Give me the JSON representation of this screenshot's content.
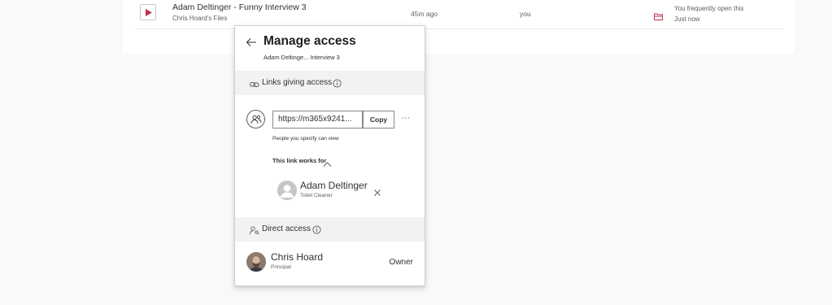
{
  "file_row": {
    "name": "Adam Deltinger - Funny Interview 3",
    "location": "Chris Hoard's Files",
    "modified": "45m ago",
    "modified_by": "you",
    "activity_line1": "You frequently open this",
    "activity_line2": "Just now",
    "video_icon": "play-icon",
    "activity_icon": "folder-open-icon",
    "accent_color": "#c4314b"
  },
  "panel": {
    "title": "Manage access",
    "subtitle": "Adam Deltinge... Interview 3",
    "back_icon": "arrow-left-icon",
    "links_section": {
      "label": "Links giving access",
      "icon": "link-icon",
      "info_icon": "info-icon",
      "link": {
        "url": "https://m365x9241...",
        "copy_label": "Copy",
        "more_label": "···",
        "audience": "People you specify can view",
        "works_for_label": "This link works for",
        "recipient": {
          "name": "Adam Deltinger",
          "role": "Toilet Cleaner"
        }
      }
    },
    "direct_section": {
      "label": "Direct access",
      "icon": "person-key-icon",
      "info_icon": "info-icon",
      "owner": {
        "name": "Chris Hoard",
        "role": "Principal",
        "permission": "Owner"
      }
    }
  }
}
